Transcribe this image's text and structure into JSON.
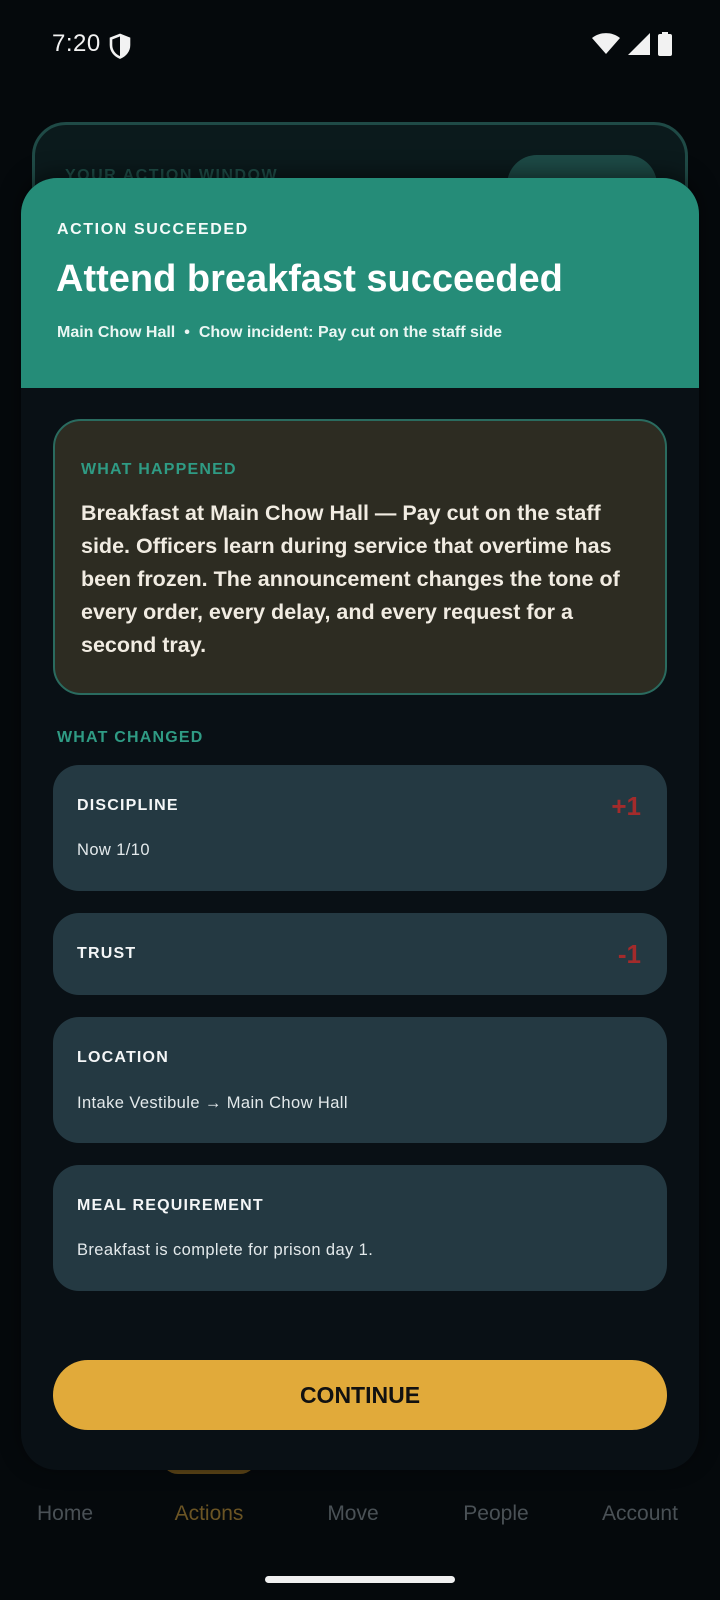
{
  "status_bar": {
    "time": "7:20"
  },
  "background": {
    "action_window_label": "YOUR ACTION WINDOW"
  },
  "bottom_nav": {
    "items": [
      {
        "label": "Home",
        "icon": "home-icon",
        "active": false
      },
      {
        "label": "Actions",
        "icon": "actions-icon",
        "active": true
      },
      {
        "label": "Move",
        "icon": "move-icon",
        "active": false
      },
      {
        "label": "People",
        "icon": "people-search-icon",
        "active": false
      },
      {
        "label": "Account",
        "icon": "account-icon",
        "active": false
      }
    ]
  },
  "modal": {
    "kicker": "ACTION SUCCEEDED",
    "title": "Attend breakfast succeeded",
    "location": "Main Chow Hall",
    "separator": "•",
    "incident": "Chow incident: Pay cut on the staff side",
    "what_happened_label": "WHAT HAPPENED",
    "what_happened_text": "Breakfast at Main Chow Hall — Pay cut on the staff side. Officers learn during service that overtime has been frozen. The announcement changes the tone of every order, every delay, and every request for a second tray.",
    "what_changed_label": "WHAT CHANGED",
    "changes": [
      {
        "title": "DISCIPLINE",
        "delta": "+1",
        "detail": "Now 1/10"
      },
      {
        "title": "TRUST",
        "delta": "-1",
        "detail": ""
      },
      {
        "title": "LOCATION",
        "delta": "",
        "detail": "Intake Vestibule → Main Chow Hall"
      },
      {
        "title": "MEAL REQUIREMENT",
        "delta": "",
        "detail": "Breakfast is complete for prison day 1."
      }
    ],
    "continue_label": "CONTINUE"
  },
  "colors": {
    "header": "#258c78",
    "accent_teal": "#2f9b84",
    "delta_red": "#a32b2b",
    "continue_button": "#e1aa3a"
  }
}
